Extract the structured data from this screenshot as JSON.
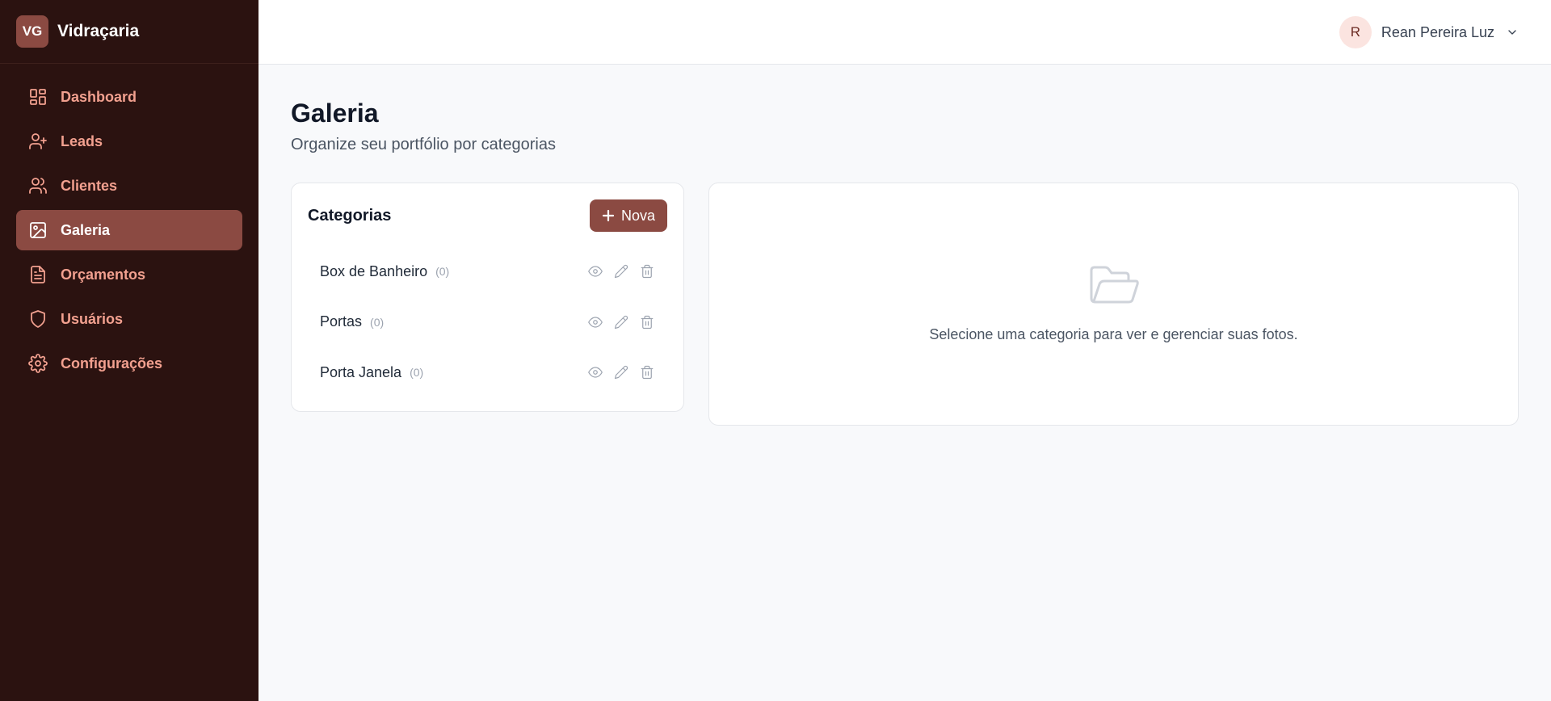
{
  "brand": {
    "badge": "VG",
    "name": "Vidraçaria"
  },
  "sidebar": {
    "items": [
      {
        "label": "Dashboard",
        "icon": "dashboard-icon",
        "active": false
      },
      {
        "label": "Leads",
        "icon": "user-plus-icon",
        "active": false
      },
      {
        "label": "Clientes",
        "icon": "users-icon",
        "active": false
      },
      {
        "label": "Galeria",
        "icon": "image-icon",
        "active": true
      },
      {
        "label": "Orçamentos",
        "icon": "file-text-icon",
        "active": false
      },
      {
        "label": "Usuários",
        "icon": "shield-icon",
        "active": false
      },
      {
        "label": "Configurações",
        "icon": "gear-icon",
        "active": false
      }
    ]
  },
  "header": {
    "user": {
      "initial": "R",
      "name": "Rean Pereira Luz"
    }
  },
  "page": {
    "title": "Galeria",
    "subtitle": "Organize seu portfólio por categorias"
  },
  "categories": {
    "title": "Categorias",
    "new_button": "Nova",
    "items": [
      {
        "name": "Box de Banheiro",
        "count": "(0)"
      },
      {
        "name": "Portas",
        "count": "(0)"
      },
      {
        "name": "Porta Janela",
        "count": "(0)"
      }
    ]
  },
  "empty_state": {
    "icon": "folder-open-icon",
    "text": "Selecione uma categoria para ver e gerenciar suas fotos."
  },
  "colors": {
    "sidebar_bg": "#2b1210",
    "accent": "#8b4a42",
    "nav_text": "#f2a08f"
  }
}
